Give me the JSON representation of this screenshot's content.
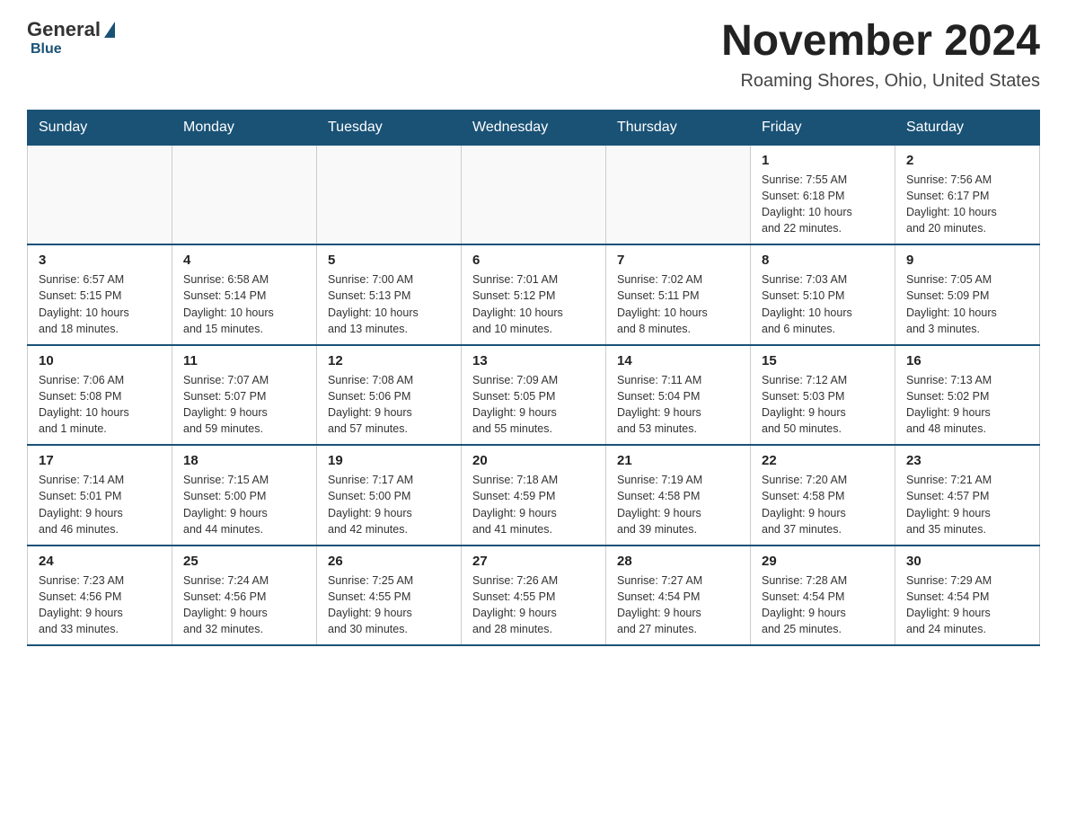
{
  "logo": {
    "general": "General",
    "blue": "Blue"
  },
  "header": {
    "title": "November 2024",
    "location": "Roaming Shores, Ohio, United States"
  },
  "weekdays": [
    "Sunday",
    "Monday",
    "Tuesday",
    "Wednesday",
    "Thursday",
    "Friday",
    "Saturday"
  ],
  "weeks": [
    [
      {
        "day": "",
        "info": ""
      },
      {
        "day": "",
        "info": ""
      },
      {
        "day": "",
        "info": ""
      },
      {
        "day": "",
        "info": ""
      },
      {
        "day": "",
        "info": ""
      },
      {
        "day": "1",
        "info": "Sunrise: 7:55 AM\nSunset: 6:18 PM\nDaylight: 10 hours\nand 22 minutes."
      },
      {
        "day": "2",
        "info": "Sunrise: 7:56 AM\nSunset: 6:17 PM\nDaylight: 10 hours\nand 20 minutes."
      }
    ],
    [
      {
        "day": "3",
        "info": "Sunrise: 6:57 AM\nSunset: 5:15 PM\nDaylight: 10 hours\nand 18 minutes."
      },
      {
        "day": "4",
        "info": "Sunrise: 6:58 AM\nSunset: 5:14 PM\nDaylight: 10 hours\nand 15 minutes."
      },
      {
        "day": "5",
        "info": "Sunrise: 7:00 AM\nSunset: 5:13 PM\nDaylight: 10 hours\nand 13 minutes."
      },
      {
        "day": "6",
        "info": "Sunrise: 7:01 AM\nSunset: 5:12 PM\nDaylight: 10 hours\nand 10 minutes."
      },
      {
        "day": "7",
        "info": "Sunrise: 7:02 AM\nSunset: 5:11 PM\nDaylight: 10 hours\nand 8 minutes."
      },
      {
        "day": "8",
        "info": "Sunrise: 7:03 AM\nSunset: 5:10 PM\nDaylight: 10 hours\nand 6 minutes."
      },
      {
        "day": "9",
        "info": "Sunrise: 7:05 AM\nSunset: 5:09 PM\nDaylight: 10 hours\nand 3 minutes."
      }
    ],
    [
      {
        "day": "10",
        "info": "Sunrise: 7:06 AM\nSunset: 5:08 PM\nDaylight: 10 hours\nand 1 minute."
      },
      {
        "day": "11",
        "info": "Sunrise: 7:07 AM\nSunset: 5:07 PM\nDaylight: 9 hours\nand 59 minutes."
      },
      {
        "day": "12",
        "info": "Sunrise: 7:08 AM\nSunset: 5:06 PM\nDaylight: 9 hours\nand 57 minutes."
      },
      {
        "day": "13",
        "info": "Sunrise: 7:09 AM\nSunset: 5:05 PM\nDaylight: 9 hours\nand 55 minutes."
      },
      {
        "day": "14",
        "info": "Sunrise: 7:11 AM\nSunset: 5:04 PM\nDaylight: 9 hours\nand 53 minutes."
      },
      {
        "day": "15",
        "info": "Sunrise: 7:12 AM\nSunset: 5:03 PM\nDaylight: 9 hours\nand 50 minutes."
      },
      {
        "day": "16",
        "info": "Sunrise: 7:13 AM\nSunset: 5:02 PM\nDaylight: 9 hours\nand 48 minutes."
      }
    ],
    [
      {
        "day": "17",
        "info": "Sunrise: 7:14 AM\nSunset: 5:01 PM\nDaylight: 9 hours\nand 46 minutes."
      },
      {
        "day": "18",
        "info": "Sunrise: 7:15 AM\nSunset: 5:00 PM\nDaylight: 9 hours\nand 44 minutes."
      },
      {
        "day": "19",
        "info": "Sunrise: 7:17 AM\nSunset: 5:00 PM\nDaylight: 9 hours\nand 42 minutes."
      },
      {
        "day": "20",
        "info": "Sunrise: 7:18 AM\nSunset: 4:59 PM\nDaylight: 9 hours\nand 41 minutes."
      },
      {
        "day": "21",
        "info": "Sunrise: 7:19 AM\nSunset: 4:58 PM\nDaylight: 9 hours\nand 39 minutes."
      },
      {
        "day": "22",
        "info": "Sunrise: 7:20 AM\nSunset: 4:58 PM\nDaylight: 9 hours\nand 37 minutes."
      },
      {
        "day": "23",
        "info": "Sunrise: 7:21 AM\nSunset: 4:57 PM\nDaylight: 9 hours\nand 35 minutes."
      }
    ],
    [
      {
        "day": "24",
        "info": "Sunrise: 7:23 AM\nSunset: 4:56 PM\nDaylight: 9 hours\nand 33 minutes."
      },
      {
        "day": "25",
        "info": "Sunrise: 7:24 AM\nSunset: 4:56 PM\nDaylight: 9 hours\nand 32 minutes."
      },
      {
        "day": "26",
        "info": "Sunrise: 7:25 AM\nSunset: 4:55 PM\nDaylight: 9 hours\nand 30 minutes."
      },
      {
        "day": "27",
        "info": "Sunrise: 7:26 AM\nSunset: 4:55 PM\nDaylight: 9 hours\nand 28 minutes."
      },
      {
        "day": "28",
        "info": "Sunrise: 7:27 AM\nSunset: 4:54 PM\nDaylight: 9 hours\nand 27 minutes."
      },
      {
        "day": "29",
        "info": "Sunrise: 7:28 AM\nSunset: 4:54 PM\nDaylight: 9 hours\nand 25 minutes."
      },
      {
        "day": "30",
        "info": "Sunrise: 7:29 AM\nSunset: 4:54 PM\nDaylight: 9 hours\nand 24 minutes."
      }
    ]
  ]
}
